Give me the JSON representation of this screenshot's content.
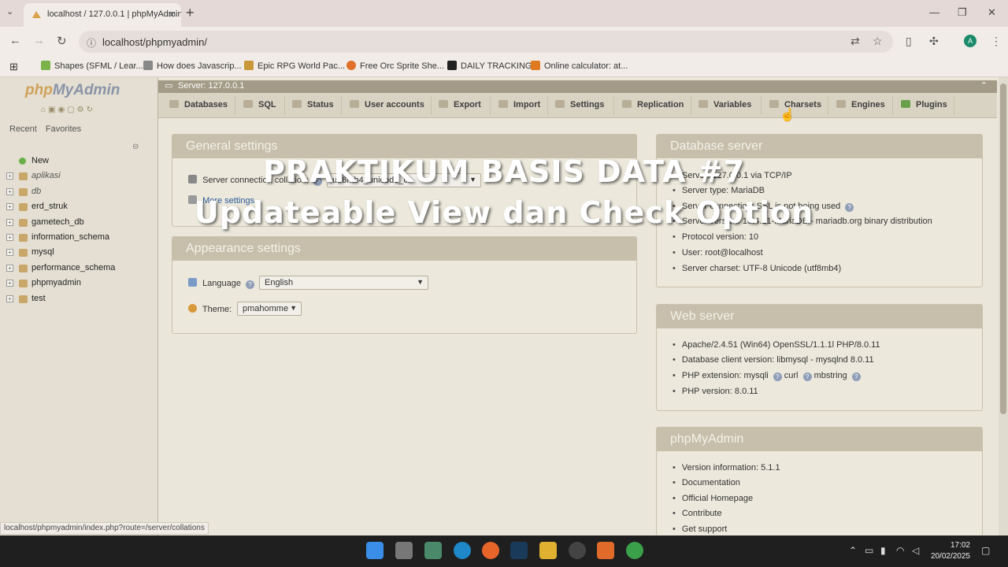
{
  "browser": {
    "tab_title": "localhost / 127.0.0.1 | phpMyAdmin",
    "url": "localhost/phpmyadmin/",
    "avatar_letter": "A",
    "bookmarks": [
      "Shapes (SFML / Lear...",
      "How does Javascrip...",
      "Epic RPG World Pac...",
      "Free Orc Sprite She...",
      "DAILY TRACKING",
      "Online calculator: at..."
    ]
  },
  "sidebar": {
    "logo_php": "php",
    "logo_myadmin": "MyAdmin",
    "tab_recent": "Recent",
    "tab_favorites": "Favorites",
    "databases": [
      "New",
      "aplikasi",
      "db",
      "erd_struk",
      "gametech_db",
      "information_schema",
      "mysql",
      "performance_schema",
      "phpmyadmin",
      "test"
    ]
  },
  "server_bar": {
    "title": "Server: 127.0.0.1"
  },
  "menu": [
    "Databases",
    "SQL",
    "Status",
    "User accounts",
    "Export",
    "Import",
    "Settings",
    "Replication",
    "Variables",
    "Charsets",
    "Engines",
    "Plugins"
  ],
  "general_settings": {
    "title": "General settings",
    "collation_label": "Server connection collation:",
    "collation_value": "utf8mb4_unicode_ci",
    "more_settings": "More settings"
  },
  "appearance_settings": {
    "title": "Appearance settings",
    "language_label": "Language",
    "language_value": "English",
    "theme_label": "Theme:",
    "theme_value": "pmahomme"
  },
  "database_server": {
    "title": "Database server",
    "items": [
      "Server: 127.0.0.1 via TCP/IP",
      "Server type: MariaDB",
      "Server connection: SSL is not being used",
      "Server version: 10.4.21-MariaDB - mariadb.org binary distribution",
      "Protocol version: 10",
      "User: root@localhost",
      "Server charset: UTF-8 Unicode (utf8mb4)"
    ]
  },
  "web_server": {
    "title": "Web server",
    "items": [
      "Apache/2.4.51 (Win64) OpenSSL/1.1.1l PHP/8.0.11",
      "Database client version: libmysql - mysqlnd 8.0.11",
      "PHP extension: mysqli",
      "PHP version: 8.0.11"
    ],
    "ext_curl": "curl",
    "ext_mbstring": "mbstring"
  },
  "phpmyadmin_info": {
    "title": "phpMyAdmin",
    "items": [
      "Version information: 5.1.1",
      "Documentation",
      "Official Homepage",
      "Contribute",
      "Get support"
    ]
  },
  "status_url": "localhost/phpmyadmin/index.php?route=/server/collations",
  "overlay": {
    "line1": "PRAKTIKUM BASIS DATA #7",
    "line2": "Updateable View dan Check Option"
  },
  "clock": {
    "time": "17:02",
    "date": "20/02/2025"
  },
  "colors": {
    "panel_header": "#c7bfab",
    "server_bar": "#a39b87",
    "taskbar": "#1f1f1f"
  }
}
